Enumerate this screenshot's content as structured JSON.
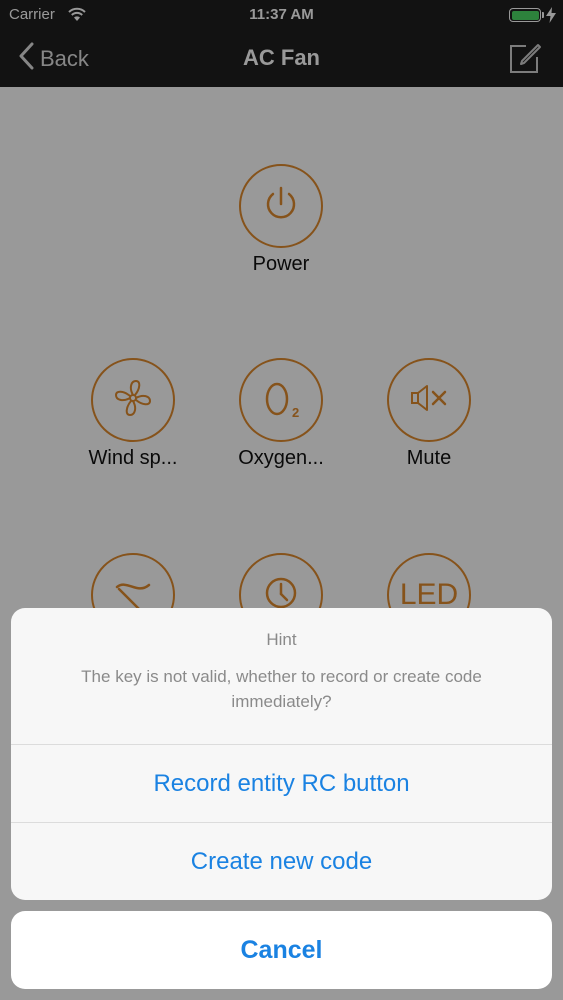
{
  "status_bar": {
    "carrier": "Carrier",
    "time": "11:37 AM"
  },
  "nav": {
    "back_label": "Back",
    "title": "AC Fan"
  },
  "buttons": {
    "power": "Power",
    "wind_speed": "Wind sp...",
    "oxygen": "Oxygen...",
    "mute": "Mute",
    "led": "LED",
    "o2_subscript": "2"
  },
  "alert": {
    "title": "Hint",
    "message": "The key is not valid, whether to record or create code immediately?",
    "record_label": "Record entity RC button",
    "create_label": "Create new code",
    "cancel_label": "Cancel"
  },
  "colors": {
    "accent": "#e08a2e",
    "link": "#1a82e2",
    "battery": "#4cd964"
  }
}
